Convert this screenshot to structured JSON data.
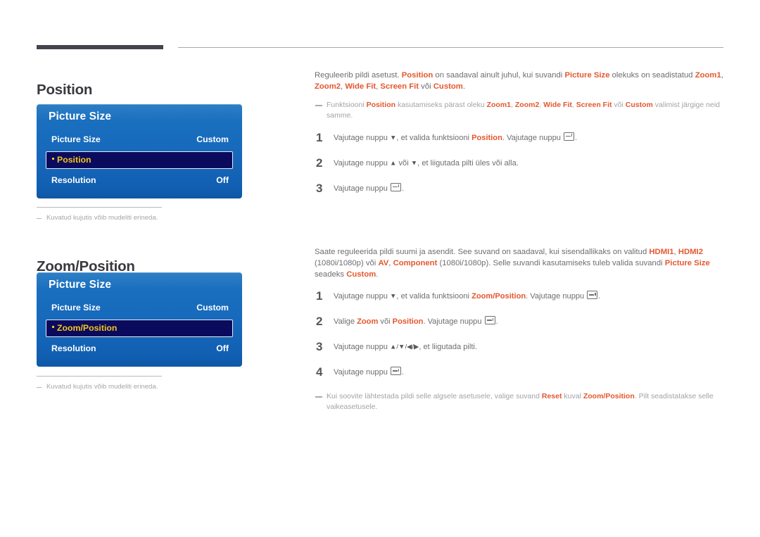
{
  "document": {
    "language": "Estonian"
  },
  "sections": [
    {
      "heading": "Position",
      "osd": {
        "title": "Picture Size",
        "rows": [
          {
            "label": "Picture Size",
            "value": "Custom",
            "selected": false
          },
          {
            "label": "Position",
            "value": "",
            "selected": true
          },
          {
            "label": "Resolution",
            "value": "Off",
            "selected": false
          }
        ]
      },
      "caption": "Kuvatud kujutis võib mudeliti erineda.",
      "intro_parts": [
        {
          "t": "Reguleerib pildi asetust. ",
          "k": "plain"
        },
        {
          "t": "Position",
          "k": "accent"
        },
        {
          "t": " on saadaval ainult juhul, kui suvandi ",
          "k": "plain"
        },
        {
          "t": "Picture Size",
          "k": "accent"
        },
        {
          "t": " olekuks on seadistatud ",
          "k": "plain"
        },
        {
          "t": "Zoom1",
          "k": "accent"
        },
        {
          "t": ", ",
          "k": "plain"
        },
        {
          "t": "Zoom2",
          "k": "accent"
        },
        {
          "t": ", ",
          "k": "plain"
        },
        {
          "t": "Wide Fit",
          "k": "accent"
        },
        {
          "t": ", ",
          "k": "plain"
        },
        {
          "t": "Screen Fit",
          "k": "accent"
        },
        {
          "t": " või ",
          "k": "plain"
        },
        {
          "t": "Custom",
          "k": "accent"
        },
        {
          "t": ".",
          "k": "plain"
        }
      ],
      "note_parts": [
        {
          "t": "Funktsiooni ",
          "k": "plain"
        },
        {
          "t": "Position",
          "k": "accent"
        },
        {
          "t": " kasutamiseks pärast oleku ",
          "k": "plain"
        },
        {
          "t": "Zoom1",
          "k": "accent"
        },
        {
          "t": ", ",
          "k": "plain"
        },
        {
          "t": "Zoom2",
          "k": "accent"
        },
        {
          "t": ", ",
          "k": "plain"
        },
        {
          "t": "Wide Fit",
          "k": "accent"
        },
        {
          "t": ", ",
          "k": "plain"
        },
        {
          "t": "Screen Fit",
          "k": "accent"
        },
        {
          "t": " või ",
          "k": "plain"
        },
        {
          "t": "Custom",
          "k": "accent"
        },
        {
          "t": " valimist järgige neid samme.",
          "k": "plain"
        }
      ],
      "steps": [
        {
          "number": "1",
          "parts": [
            {
              "t": "Vajutage nuppu ",
              "k": "plain"
            },
            {
              "t": "▼",
              "k": "arrow"
            },
            {
              "t": ", et valida funktsiooni ",
              "k": "plain"
            },
            {
              "t": "Position",
              "k": "accent"
            },
            {
              "t": ". Vajutage nuppu ",
              "k": "plain"
            },
            {
              "t": "enter-key-icon",
              "k": "enter"
            },
            {
              "t": ".",
              "k": "plain"
            }
          ]
        },
        {
          "number": "2",
          "parts": [
            {
              "t": "Vajutage nuppu ",
              "k": "plain"
            },
            {
              "t": "▲",
              "k": "arrow"
            },
            {
              "t": " või ",
              "k": "plain"
            },
            {
              "t": "▼",
              "k": "arrow"
            },
            {
              "t": ", et liigutada pilti üles või alla.",
              "k": "plain"
            }
          ]
        },
        {
          "number": "3",
          "parts": [
            {
              "t": "Vajutage nuppu ",
              "k": "plain"
            },
            {
              "t": "enter-key-icon",
              "k": "enter"
            },
            {
              "t": ".",
              "k": "plain"
            }
          ]
        }
      ],
      "footnote_parts": []
    },
    {
      "heading": "Zoom/Position",
      "osd": {
        "title": "Picture Size",
        "rows": [
          {
            "label": "Picture Size",
            "value": "Custom",
            "selected": false
          },
          {
            "label": "Zoom/Position",
            "value": "",
            "selected": true
          },
          {
            "label": "Resolution",
            "value": "Off",
            "selected": false
          }
        ]
      },
      "caption": "Kuvatud kujutis võib mudeliti erineda.",
      "intro_parts": [
        {
          "t": "Saate reguleerida pildi suumi ja asendit. See suvand on saadaval, kui sisendallikaks on valitud ",
          "k": "plain"
        },
        {
          "t": "HDMI1",
          "k": "accent"
        },
        {
          "t": ", ",
          "k": "plain"
        },
        {
          "t": "HDMI2",
          "k": "accent"
        },
        {
          "t": " (1080i/1080p) või ",
          "k": "plain"
        },
        {
          "t": "AV",
          "k": "accent"
        },
        {
          "t": ", ",
          "k": "plain"
        },
        {
          "t": "Component",
          "k": "accent"
        },
        {
          "t": " (1080i/1080p). Selle suvandi kasutamiseks tuleb valida suvandi ",
          "k": "plain"
        },
        {
          "t": "Picture Size",
          "k": "accent"
        },
        {
          "t": " seadeks ",
          "k": "plain"
        },
        {
          "t": "Custom",
          "k": "accent"
        },
        {
          "t": ".",
          "k": "plain"
        }
      ],
      "note_parts": [],
      "steps": [
        {
          "number": "1",
          "parts": [
            {
              "t": "Vajutage nuppu ",
              "k": "plain"
            },
            {
              "t": "▼",
              "k": "arrow"
            },
            {
              "t": ", et valida funktsiooni ",
              "k": "plain"
            },
            {
              "t": "Zoom/Position",
              "k": "accent"
            },
            {
              "t": ". Vajutage nuppu ",
              "k": "plain"
            },
            {
              "t": "enter-key-icon",
              "k": "enter"
            },
            {
              "t": ".",
              "k": "plain"
            }
          ]
        },
        {
          "number": "2",
          "parts": [
            {
              "t": "Valige ",
              "k": "plain"
            },
            {
              "t": "Zoom",
              "k": "accent"
            },
            {
              "t": " või ",
              "k": "plain"
            },
            {
              "t": "Position",
              "k": "accent"
            },
            {
              "t": ". Vajutage nuppu ",
              "k": "plain"
            },
            {
              "t": "enter-key-icon",
              "k": "enter"
            },
            {
              "t": ".",
              "k": "plain"
            }
          ]
        },
        {
          "number": "3",
          "parts": [
            {
              "t": "Vajutage nuppu ",
              "k": "plain"
            },
            {
              "t": "▲/▼/◀/▶",
              "k": "arrow"
            },
            {
              "t": ", et liigutada pilti.",
              "k": "plain"
            }
          ]
        },
        {
          "number": "4",
          "parts": [
            {
              "t": "Vajutage nuppu ",
              "k": "plain"
            },
            {
              "t": "enter-key-icon",
              "k": "enter"
            },
            {
              "t": ".",
              "k": "plain"
            }
          ]
        }
      ],
      "footnote_parts": [
        {
          "t": "Kui soovite lähtestada pildi selle algsele asetusele, valige suvand ",
          "k": "plain"
        },
        {
          "t": "Reset",
          "k": "accent"
        },
        {
          "t": " kuval ",
          "k": "plain"
        },
        {
          "t": "Zoom/Position",
          "k": "accent"
        },
        {
          "t": ". Pilt seadistatakse selle vaikeasetusele.",
          "k": "plain"
        }
      ]
    }
  ],
  "colors": {
    "accent": "#e4572e",
    "osd_blue_top": "#2e7fc4",
    "osd_blue_bottom": "#0f57a6",
    "osd_selected_bg": "#0b0b5e",
    "osd_selected_text": "#f5c518",
    "heading": "#3a383f",
    "body_text": "#6e6e74",
    "note_text": "#a3a3a9"
  }
}
